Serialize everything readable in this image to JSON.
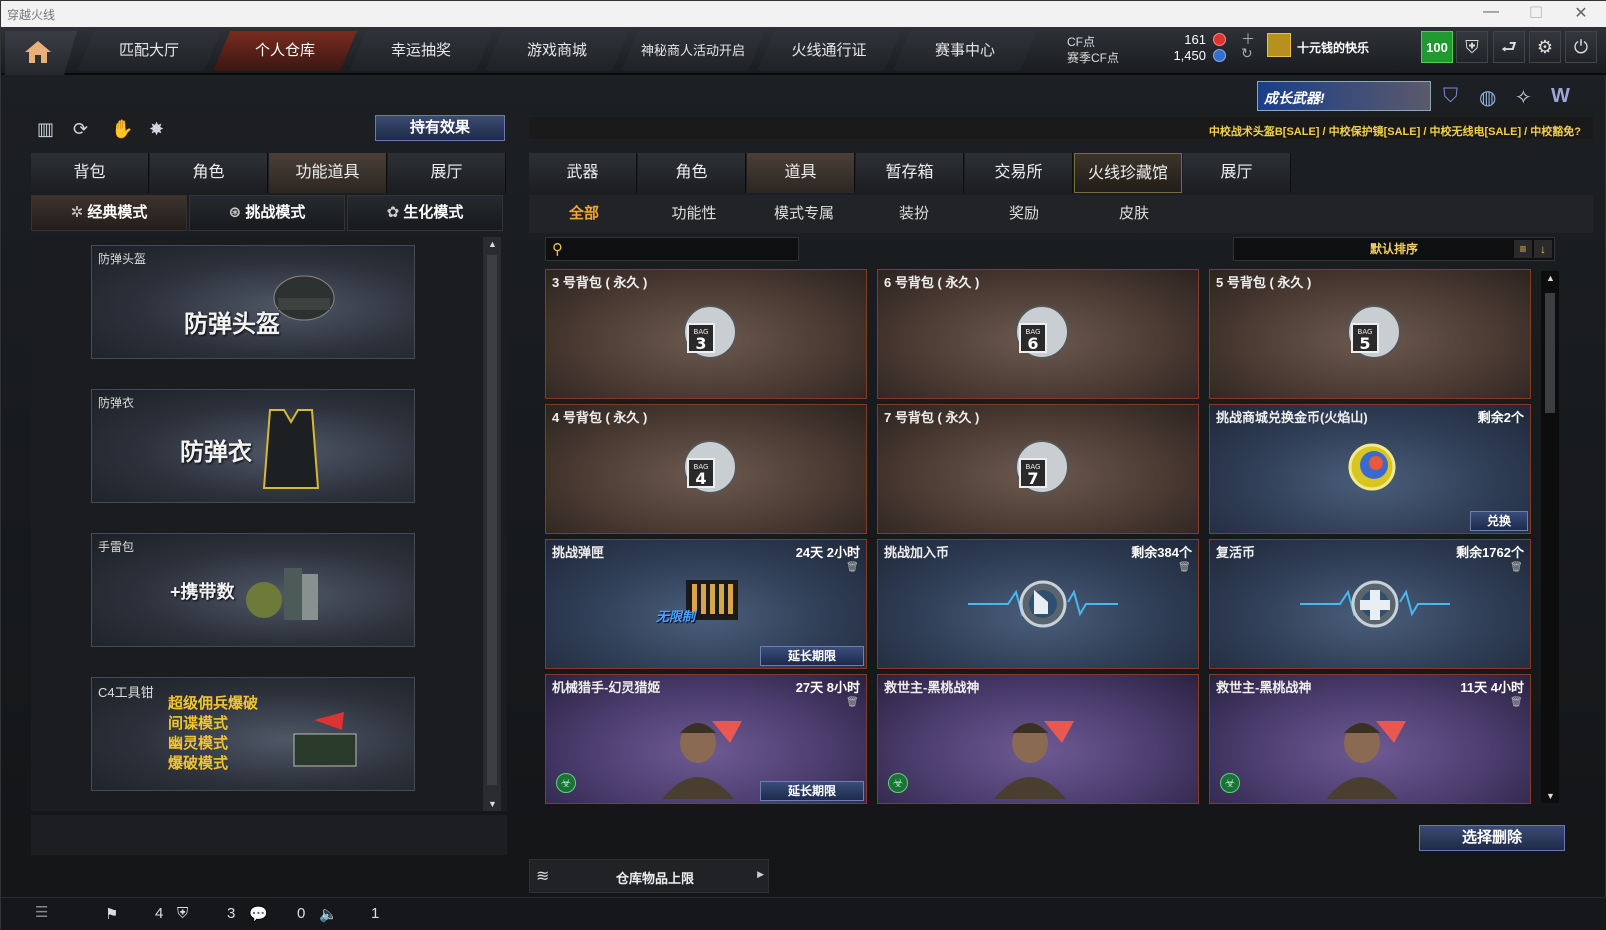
{
  "window": {
    "title": "穿越火线"
  },
  "nav": {
    "tabs": [
      "匹配大厅",
      "个人仓库",
      "幸运抽奖",
      "游戏商城",
      "神秘商人活动开启",
      "火线通行证",
      "赛事中心"
    ],
    "active": 1,
    "cf_label": "CF点",
    "season_cf_label": "赛季CF点",
    "cf_value": "161",
    "season_cf_value": "1,450",
    "username": "十元钱的快乐",
    "level": "100"
  },
  "left": {
    "effect_button": "持有效果",
    "tabs": [
      "背包",
      "角色",
      "功能道具",
      "展厅"
    ],
    "active_tab": 2,
    "modes": [
      "经典模式",
      "挑战模式",
      "生化模式"
    ],
    "items": [
      {
        "label": "防弹头盔",
        "title": "防弹头盔"
      },
      {
        "label": "防弹衣",
        "title": "防弹衣"
      },
      {
        "label": "手雷包",
        "title": "+携带数"
      },
      {
        "label": "C4工具钳",
        "lines": [
          "超级佣兵爆破",
          "间谍模式",
          "幽灵模式",
          "爆破模式"
        ]
      }
    ]
  },
  "right": {
    "banner": "成长武器!",
    "sale_text": "中校战术头盔B[SALE] / 中校保护镜[SALE] / 中校无线电[SALE] / 中校豁免?",
    "tabs": [
      "武器",
      "角色",
      "道具",
      "暂存箱",
      "交易所",
      "火线珍藏馆",
      "展厅"
    ],
    "active_tab": 2,
    "subtabs": [
      "全部",
      "功能性",
      "模式专属",
      "装扮",
      "奖励",
      "皮肤"
    ],
    "active_subtab": 0,
    "search_placeholder": "",
    "sort_label": "默认排序",
    "items": [
      {
        "name": "3 号背包 ( 永久 )",
        "info": "",
        "style": "brown",
        "bag": "3"
      },
      {
        "name": "6 号背包 ( 永久 )",
        "info": "",
        "style": "brown",
        "bag": "6"
      },
      {
        "name": "5 号背包 ( 永久 )",
        "info": "",
        "style": "brown",
        "bag": "5"
      },
      {
        "name": "4 号背包 ( 永久 )",
        "info": "",
        "style": "brown",
        "bag": "4"
      },
      {
        "name": "7 号背包 ( 永久 )",
        "info": "",
        "style": "brown",
        "bag": "7"
      },
      {
        "name": "挑战商城兑换金币(火焰山)",
        "info": "剩余2个",
        "style": "blue",
        "action": "兑换",
        "icon": "coin"
      },
      {
        "name": "挑战弹匣",
        "info": "24天 2小时",
        "style": "blue",
        "action": "延长期限",
        "icon": "ammo",
        "badge": "无限制"
      },
      {
        "name": "挑战加入币",
        "info": "剩余384个",
        "style": "blue",
        "icon": "join"
      },
      {
        "name": "复活币",
        "info": "剩余1762个",
        "style": "blue",
        "icon": "revive"
      },
      {
        "name": "机械猎手-幻灵猎姬",
        "info": "27天 8小时",
        "style": "purple",
        "action": "延长期限",
        "icon": "char"
      },
      {
        "name": "救世主-黑桃战神",
        "info": "",
        "style": "purple",
        "icon": "char"
      },
      {
        "name": "救世主-黑桃战神",
        "info": "11天 4小时",
        "style": "purple",
        "icon": "char"
      }
    ],
    "delete_button": "选择删除",
    "capacity_label": "仓库物品上限"
  },
  "status": {
    "values": [
      "4",
      "3",
      "0",
      "1"
    ]
  }
}
